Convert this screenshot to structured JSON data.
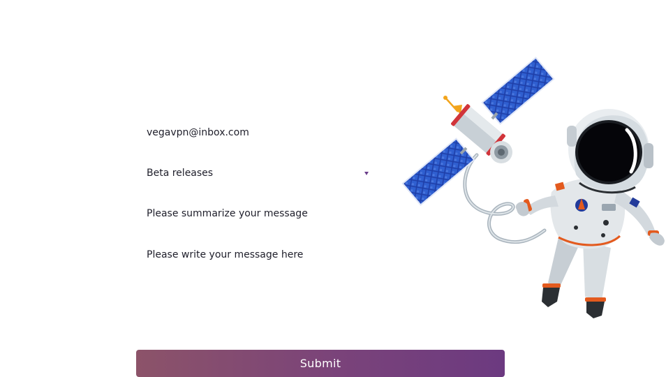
{
  "form": {
    "email_value": "vegavpn@inbox.com",
    "topic_selected": "Beta releases",
    "subject_placeholder": "Please summarize your message",
    "message_placeholder": "Please write your message here",
    "submit_label": "Submit"
  },
  "illustration": {
    "subject": "astronaut-and-satellite",
    "colors": {
      "suit": "#e3e7ea",
      "suit_shadow": "#a6b0b8",
      "visor": "#0a0a1a",
      "accent": "#e35a1e",
      "panel": "#1f3fa8"
    }
  },
  "colors": {
    "button_gradient_start": "#8c5369",
    "button_gradient_end": "#6c3a80",
    "caret": "#6a3d8a"
  }
}
